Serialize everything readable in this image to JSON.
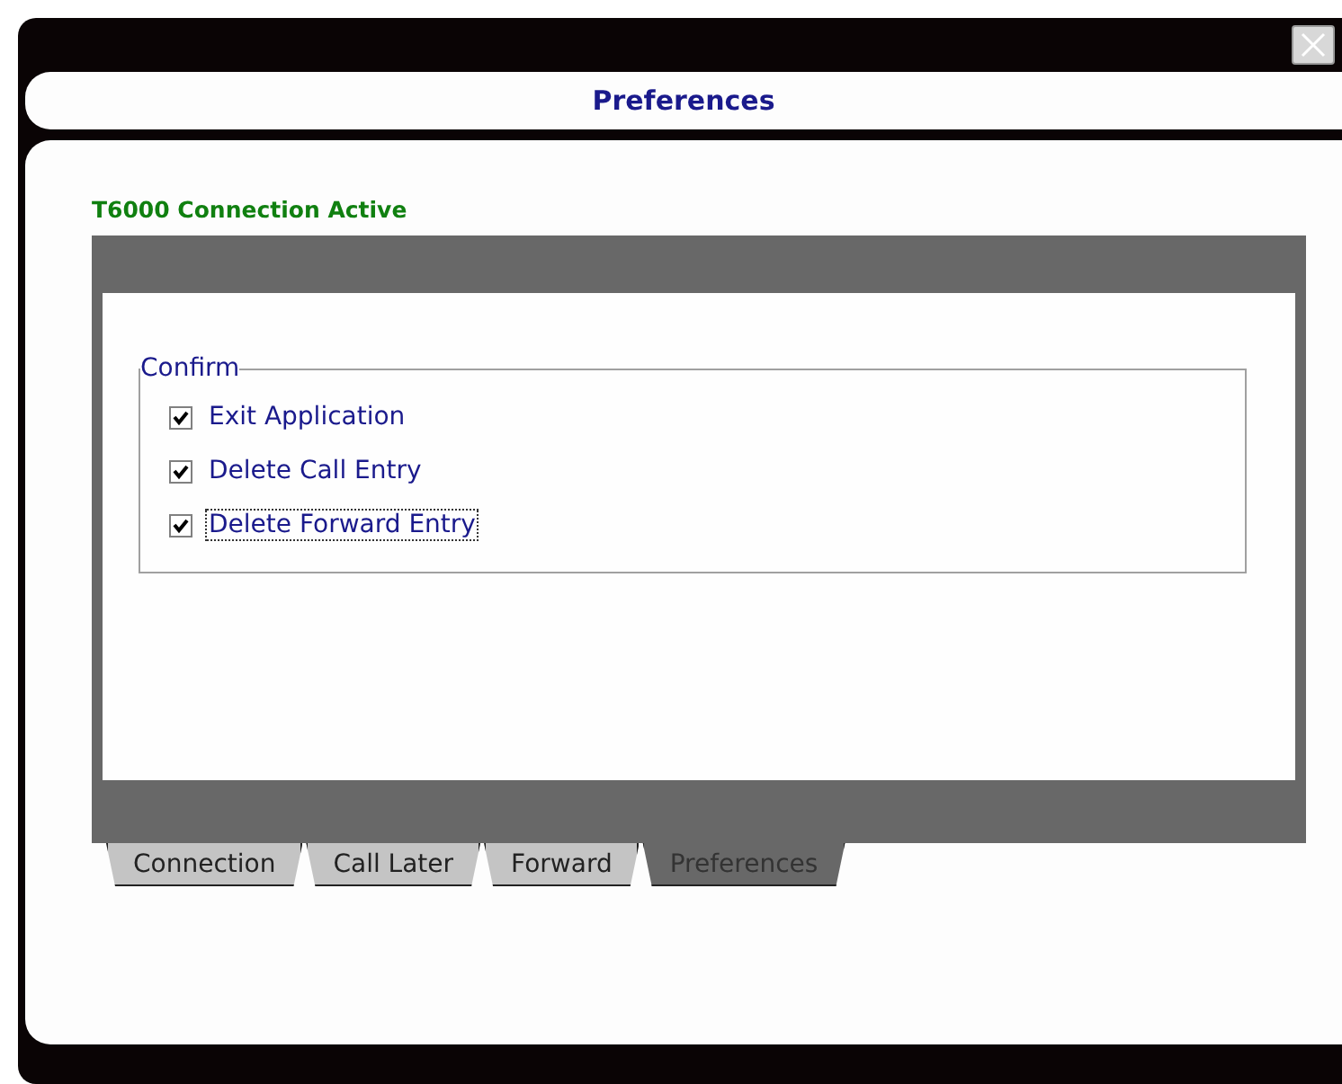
{
  "window": {
    "title": "Preferences"
  },
  "status": "T6000 Connection Active",
  "group": {
    "title": "Confirm",
    "options": [
      {
        "label": "Exit Application",
        "checked": true,
        "focused": false
      },
      {
        "label": "Delete Call Entry",
        "checked": true,
        "focused": false
      },
      {
        "label": "Delete Forward Entry",
        "checked": true,
        "focused": true
      }
    ]
  },
  "tabs": [
    {
      "label": "Connection",
      "selected": false
    },
    {
      "label": "Call Later",
      "selected": false
    },
    {
      "label": "Forward",
      "selected": false
    },
    {
      "label": "Preferences",
      "selected": true
    }
  ]
}
